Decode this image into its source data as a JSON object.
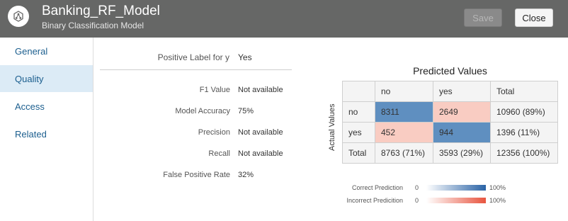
{
  "header": {
    "title": "Banking_RF_Model",
    "subtitle": "Binary Classification Model",
    "save_label": "Save",
    "close_label": "Close",
    "logo_icon": "model-node-icon"
  },
  "sidebar": {
    "items": [
      {
        "label": "General",
        "active": false
      },
      {
        "label": "Quality",
        "active": true
      },
      {
        "label": "Access",
        "active": false
      },
      {
        "label": "Related",
        "active": false
      }
    ]
  },
  "quality": {
    "positive_label": {
      "label": "Positive Label for y",
      "value": "Yes"
    },
    "metrics": [
      {
        "label": "F1 Value",
        "value": "Not available"
      },
      {
        "label": "Model Accuracy",
        "value": "75%"
      },
      {
        "label": "Precision",
        "value": "Not available"
      },
      {
        "label": "Recall",
        "value": "Not available"
      },
      {
        "label": "False Positive Rate",
        "value": "32%"
      }
    ]
  },
  "confusion_matrix": {
    "title": "Predicted Values",
    "y_axis_label": "Actual Values",
    "column_headers": [
      "",
      "no",
      "yes",
      "Total"
    ],
    "rows": [
      {
        "cells": [
          "no",
          "8311",
          "2649",
          "10960 (89%)"
        ],
        "kinds": [
          "header",
          "correct",
          "incorrect",
          "total"
        ]
      },
      {
        "cells": [
          "yes",
          "452",
          "944",
          "1396 (11%)"
        ],
        "kinds": [
          "header",
          "incorrect",
          "correct",
          "total"
        ]
      },
      {
        "cells": [
          "Total",
          "8763 (71%)",
          "3593 (29%)",
          "12356 (100%)"
        ],
        "kinds": [
          "header",
          "total",
          "total",
          "total"
        ]
      }
    ],
    "colors": {
      "correct": "#5f8fc0",
      "incorrect": "#f9ccc2",
      "header": "#f4f4f4",
      "total": "#f4f4f4"
    }
  },
  "legend": {
    "items": [
      {
        "label": "Correct Prediction",
        "min": "0",
        "max": "100%",
        "color_start": "#ffffff",
        "color_end": "#2a63a6"
      },
      {
        "label": "Incorrect Predicition",
        "min": "0",
        "max": "100%",
        "color_start": "#ffffff",
        "color_end": "#e8553f"
      }
    ]
  }
}
